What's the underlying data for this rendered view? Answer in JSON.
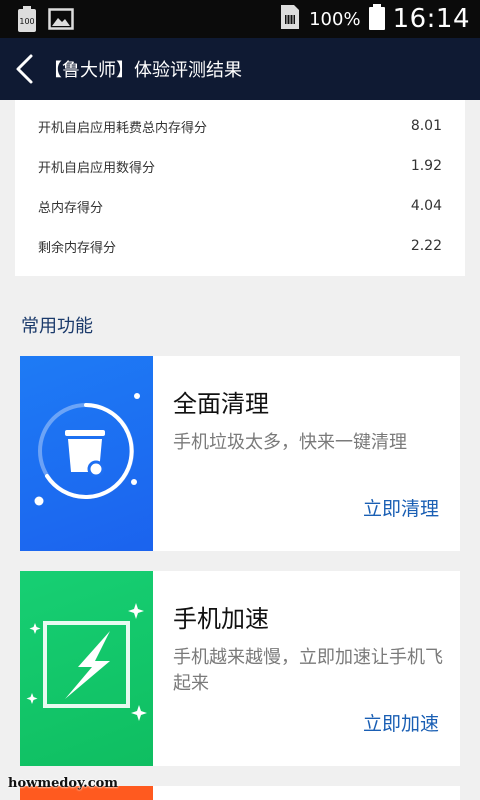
{
  "status_bar": {
    "battery_level_label": "100",
    "battery_percent": "100%",
    "time": "16:14"
  },
  "nav": {
    "title": "【鲁大师】体验评测结果"
  },
  "scores": [
    {
      "label": "开机自启应用耗费总内存得分",
      "value": "8.01"
    },
    {
      "label": "开机自启应用数得分",
      "value": "1.92"
    },
    {
      "label": "总内存得分",
      "value": "4.04"
    },
    {
      "label": "剩余内存得分",
      "value": "2.22"
    }
  ],
  "section": {
    "title": "常用功能"
  },
  "features": [
    {
      "title": "全面清理",
      "desc": "手机垃圾太多，快来一键清理",
      "action": "立即清理",
      "icon": "trash-can-icon",
      "color": "#1e6ff2"
    },
    {
      "title": "手机加速",
      "desc": "手机越来越慢，立即加速让手机飞起来",
      "action": "立即加速",
      "icon": "lightning-bolt-icon",
      "color": "#14c76b"
    }
  ],
  "watermark": "howmedoy.com",
  "colors": {
    "nav_bg": "#0f1a33",
    "accent_link": "#1a5fb4",
    "section_title": "#1b3a6b",
    "peek_card": "#ff5a1f"
  }
}
